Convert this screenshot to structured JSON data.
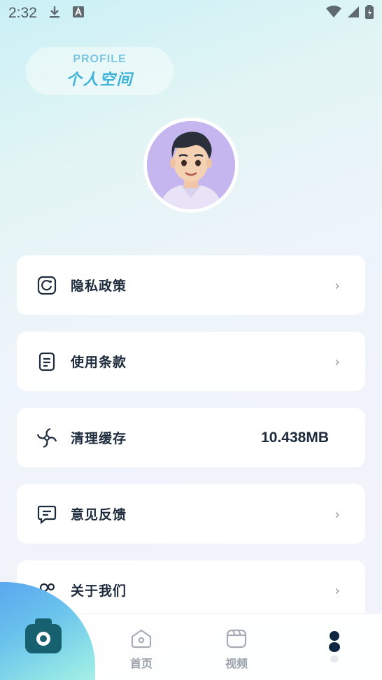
{
  "status_bar": {
    "time": "2:32"
  },
  "header": {
    "profile_en": "PROFILE",
    "profile_cn": "个人空间"
  },
  "menu": [
    {
      "label": "隐私政策",
      "icon": "privacy-icon"
    },
    {
      "label": "使用条款",
      "icon": "document-icon"
    },
    {
      "label": "清理缓存",
      "icon": "fan-icon",
      "value": "10.438MB"
    },
    {
      "label": "意见反馈",
      "icon": "feedback-icon"
    },
    {
      "label": "关于我们",
      "icon": "people-icon"
    }
  ],
  "tabbar": {
    "home_label": "首页",
    "video_label": "视频"
  },
  "colors": {
    "accent": "#3fb2d8",
    "text": "#1d2b3c",
    "muted": "#9aa3ab"
  }
}
